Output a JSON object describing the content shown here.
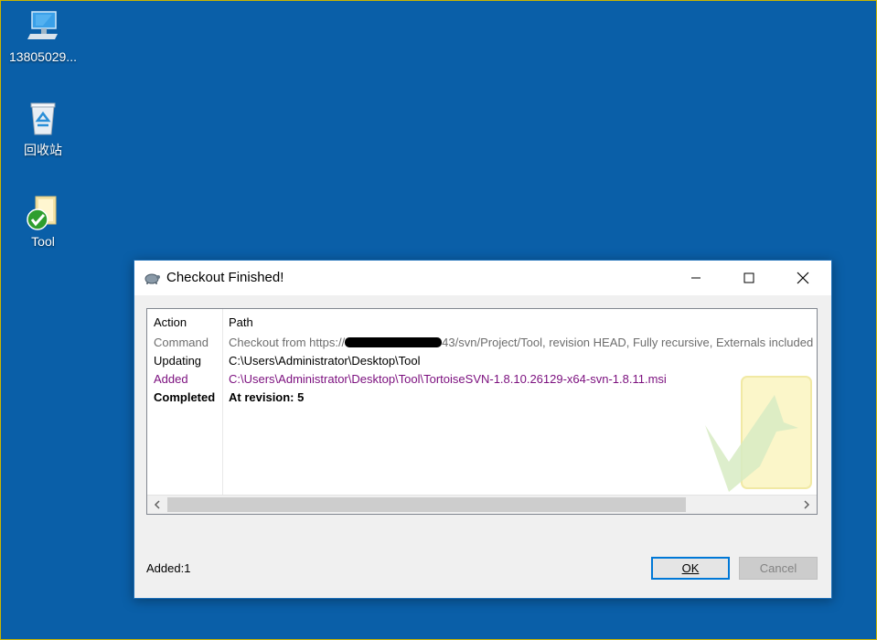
{
  "desktop": {
    "icons": [
      {
        "label": "13805029..."
      },
      {
        "label": "回收站"
      },
      {
        "label": "Tool"
      }
    ]
  },
  "dialog": {
    "title": "Checkout Finished!",
    "columns": {
      "action": "Action",
      "path": "Path"
    },
    "rows": [
      {
        "action": "Command",
        "path_prefix": "Checkout from https://",
        "path_suffix": "43/svn/Project/Tool, revision HEAD, Fully recursive, Externals included"
      },
      {
        "action": "Updating",
        "path": "C:\\Users\\Administrator\\Desktop\\Tool"
      },
      {
        "action": "Added",
        "path": "C:\\Users\\Administrator\\Desktop\\Tool\\TortoiseSVN-1.8.10.26129-x64-svn-1.8.11.msi"
      },
      {
        "action": "Completed",
        "path": "At revision: 5"
      }
    ],
    "status_text": "Added:1",
    "buttons": {
      "ok": "OK",
      "cancel": "Cancel"
    }
  }
}
